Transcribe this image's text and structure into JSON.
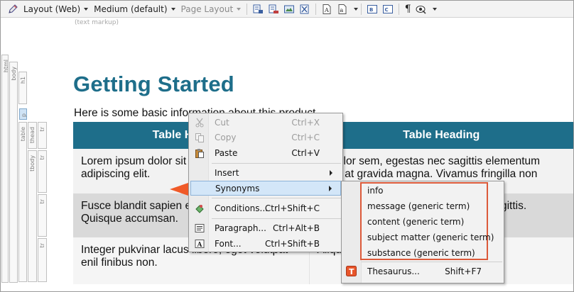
{
  "toolbar": {
    "layout": "Layout (Web)",
    "medium": "Medium (default)",
    "page_layout": "Page Layout"
  },
  "editor": {
    "markup_label": "(text markup)",
    "structure": [
      "html",
      "body",
      "h1",
      "p",
      "table",
      "thead",
      "tr",
      "tbody",
      "tr",
      "tr",
      "tr"
    ],
    "title": "Getting Started",
    "paragraph": "Here is some basic information about this product.",
    "table": {
      "headings": [
        "Table Heading",
        "Table Heading"
      ],
      "rows": [
        [
          "Lorem ipsum dolor sit amet, consectetur adipiscing elit.",
          "Ut dolor sem, egestas nec sagittis elementum arcu, at gravida magna. Vivamus fringilla non mollis id."
        ],
        [
          "Fusce blandit sapien et elit ultricies lacinia. Quisque accumsan.",
          "Nam vel ipsum eget mauris aliquet sagittis. Aliquam aliqual nec."
        ],
        [
          "Integer pukvinar lacus libero, eget volutpat enil finibus non.",
          "Aliquam vel nulla vitae lectus."
        ]
      ]
    }
  },
  "context_menu": {
    "items": [
      {
        "label": "Cut",
        "shortcut": "Ctrl+X",
        "icon": "scissors-icon"
      },
      {
        "label": "Copy",
        "shortcut": "Ctrl+C",
        "icon": "copy-icon"
      },
      {
        "label": "Paste",
        "shortcut": "Ctrl+V",
        "icon": "paste-icon"
      },
      {
        "label": "Insert"
      },
      {
        "label": "Synonyms"
      },
      {
        "label": "Conditions...",
        "shortcut": "Ctrl+Shift+C",
        "icon": "condition-tag-icon"
      },
      {
        "label": "Paragraph...",
        "shortcut": "Ctrl+Alt+B",
        "icon": "paragraph-icon"
      },
      {
        "label": "Font...",
        "shortcut": "Ctrl+Shift+B",
        "icon": "font-icon"
      }
    ]
  },
  "synonyms_menu": {
    "items": [
      "info",
      "message (generic term)",
      "content (generic term)",
      "subject matter (generic term)",
      "substance (generic term)"
    ],
    "thesaurus": {
      "label": "Thesaurus...",
      "shortcut": "Shift+F7",
      "icon": "thesaurus-icon"
    }
  },
  "colors": {
    "title": "#1e6e8a",
    "table_header": "#1e6e8a",
    "highlight_box": "#dc5a3a",
    "callout_arrow": "#f05a28"
  }
}
